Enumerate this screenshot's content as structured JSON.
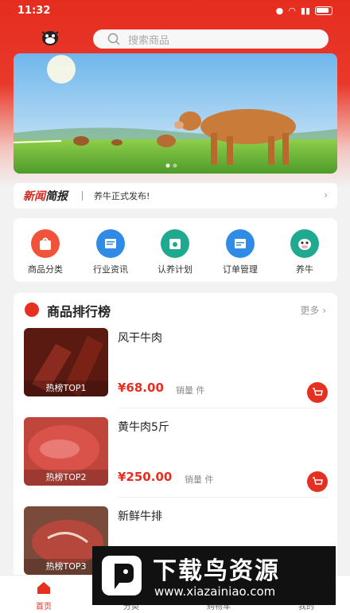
{
  "status_bar": {
    "time": "11:32"
  },
  "search": {
    "placeholder": "搜索商品"
  },
  "news": {
    "logo_red": "新闻",
    "logo_black": "简报",
    "text": "养牛正式发布!"
  },
  "menu": [
    {
      "label": "商品分类",
      "icon": "bag-icon",
      "color": "#f0523a"
    },
    {
      "label": "行业资讯",
      "icon": "news-icon",
      "color": "#2f8be6"
    },
    {
      "label": "认养计划",
      "icon": "calendar-icon",
      "color": "#1fa98e"
    },
    {
      "label": "订单管理",
      "icon": "order-icon",
      "color": "#2f8be6"
    },
    {
      "label": "养牛",
      "icon": "cow-icon",
      "color": "#1fa98e"
    }
  ],
  "ranking": {
    "title": "商品排行榜",
    "more": "更多",
    "products": [
      {
        "name": "风干牛肉",
        "price": "¥68.00",
        "sales": "销量 件",
        "tag": "热榜TOP1"
      },
      {
        "name": "黄牛肉5斤",
        "price": "¥250.00",
        "sales": "销量 件",
        "tag": "热榜TOP2"
      },
      {
        "name": "新鲜牛排",
        "price": "",
        "sales": "",
        "tag": "热榜TOP3"
      }
    ]
  },
  "tabbar": [
    {
      "label": "首页",
      "active": true
    },
    {
      "label": "分类"
    },
    {
      "label": "购物车"
    },
    {
      "label": "我的"
    }
  ],
  "watermark": {
    "title": "下载鸟资源",
    "url": "www.xiazainiao.com"
  },
  "colors": {
    "primary": "#e53021",
    "header": "#e52d1f"
  }
}
